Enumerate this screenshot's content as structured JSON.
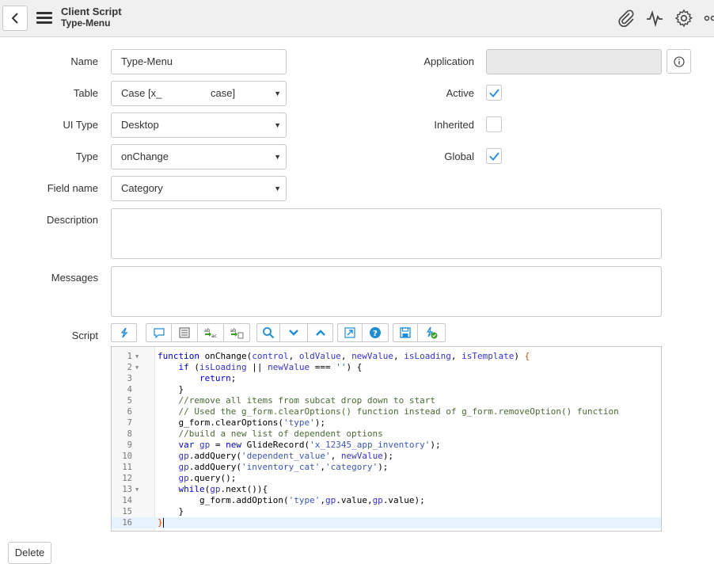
{
  "header": {
    "title": "Client Script",
    "subtitle": "Type-Menu"
  },
  "form": {
    "name_label": "Name",
    "name_value": "Type-Menu",
    "table_label": "Table",
    "table_value_prefix": "Case [x_",
    "table_value_suffix": "case]",
    "ui_type_label": "UI Type",
    "ui_type_value": "Desktop",
    "type_label": "Type",
    "type_value": "onChange",
    "field_name_label": "Field name",
    "field_name_value": "Category",
    "description_label": "Description",
    "messages_label": "Messages",
    "script_label": "Script",
    "application_label": "Application",
    "application_value": "",
    "active_label": "Active",
    "active_checked": true,
    "inherited_label": "Inherited",
    "inherited_checked": false,
    "global_label": "Global",
    "global_checked": true
  },
  "editor": {
    "line_numbers": [
      "1",
      "2",
      "3",
      "4",
      "5",
      "6",
      "7",
      "8",
      "9",
      "10",
      "11",
      "12",
      "13",
      "14",
      "15",
      "16"
    ],
    "foldable_lines": [
      1,
      2,
      13
    ]
  },
  "buttons": {
    "delete": "Delete"
  },
  "colors": {
    "accent": "#1f8dd6",
    "keyword": "#0000cc",
    "comment": "#4a6a35"
  }
}
